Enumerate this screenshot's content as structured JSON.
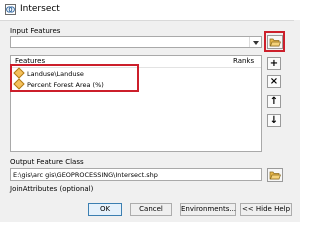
{
  "window": {
    "title": "Intersect"
  },
  "input_features": {
    "label": "Input Features",
    "value": "",
    "list_header": {
      "features": "Features",
      "ranks": "Ranks"
    },
    "items": [
      {
        "name": "Landuse\\Landuse",
        "rank": ""
      },
      {
        "name": "Percent Forest Area (%)",
        "rank": ""
      }
    ]
  },
  "side_buttons": {
    "add": "+",
    "remove": "×",
    "up": "↑",
    "down": "↓"
  },
  "output": {
    "label": "Output Feature Class",
    "value": "E:\\gis\\arc gis\\GEOPROCESSING\\Intersect.shp"
  },
  "join_attributes": {
    "label": "JoinAttributes (optional)"
  },
  "buttons": {
    "ok": "OK",
    "cancel": "Cancel",
    "environments": "Environments...",
    "hide_help": "<< Hide Help"
  },
  "colors": {
    "highlight": "#cc1f2b",
    "accent": "#3c7fb1"
  }
}
